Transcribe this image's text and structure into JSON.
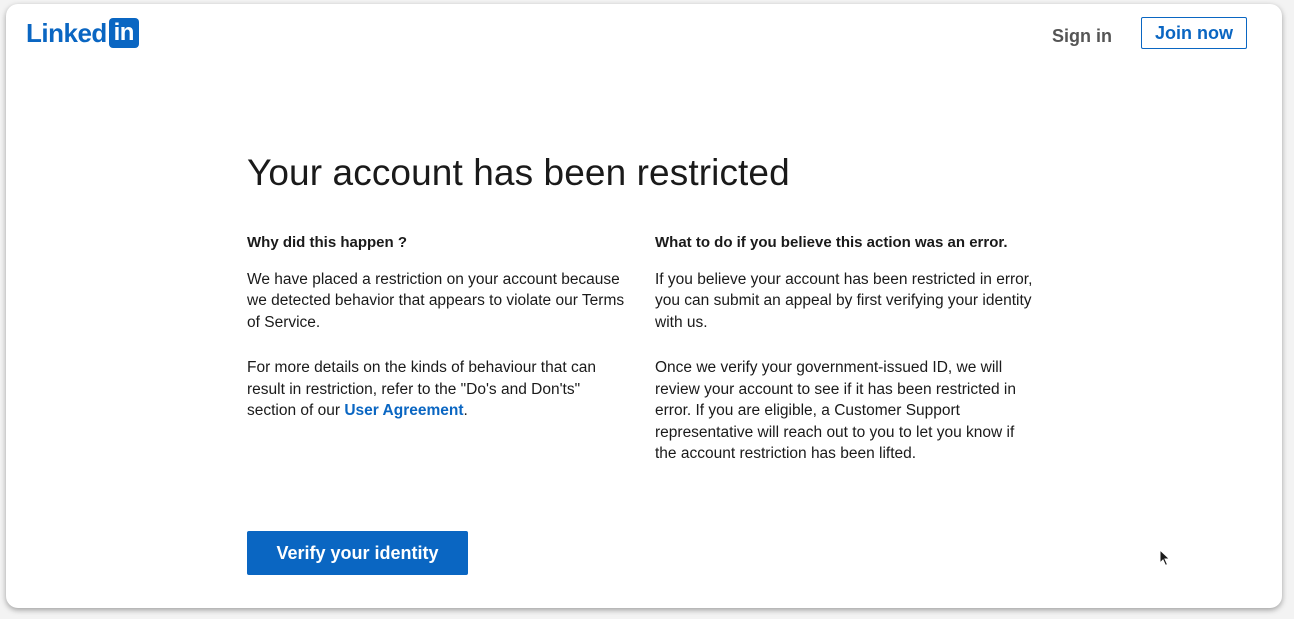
{
  "header": {
    "logo_text": "Linked",
    "logo_box": "in",
    "signin_label": "Sign in",
    "joinnow_label": "Join now"
  },
  "main": {
    "title": "Your account has been restricted",
    "left": {
      "heading": "Why did this happen ?",
      "p1": "We have placed a restriction on your account because we detected behavior that appears to violate our Terms of Service.",
      "p2_prefix": "For more details on the kinds of behaviour that can result in restriction, refer to the \"Do's and Don'ts\" section of our ",
      "p2_link": "User Agreement",
      "p2_suffix": "."
    },
    "right": {
      "heading": "What to do if you believe this action was an error.",
      "p1": "If you believe your account has been restricted in error, you can submit an appeal by first verifying your identity with us.",
      "p2": "Once we verify your government-issued ID, we will review your account to see if it has been restricted in error. If you are eligible, a Customer Support representative will reach out to you to let you know if the account restriction has been lifted."
    },
    "verify_label": "Verify your identity"
  },
  "colors": {
    "brand": "#0a66c2",
    "text": "#1a1a1a",
    "muted": "#555555"
  },
  "icons": {
    "logo": "linkedin-logo",
    "cursor": "mouse-pointer-icon"
  }
}
